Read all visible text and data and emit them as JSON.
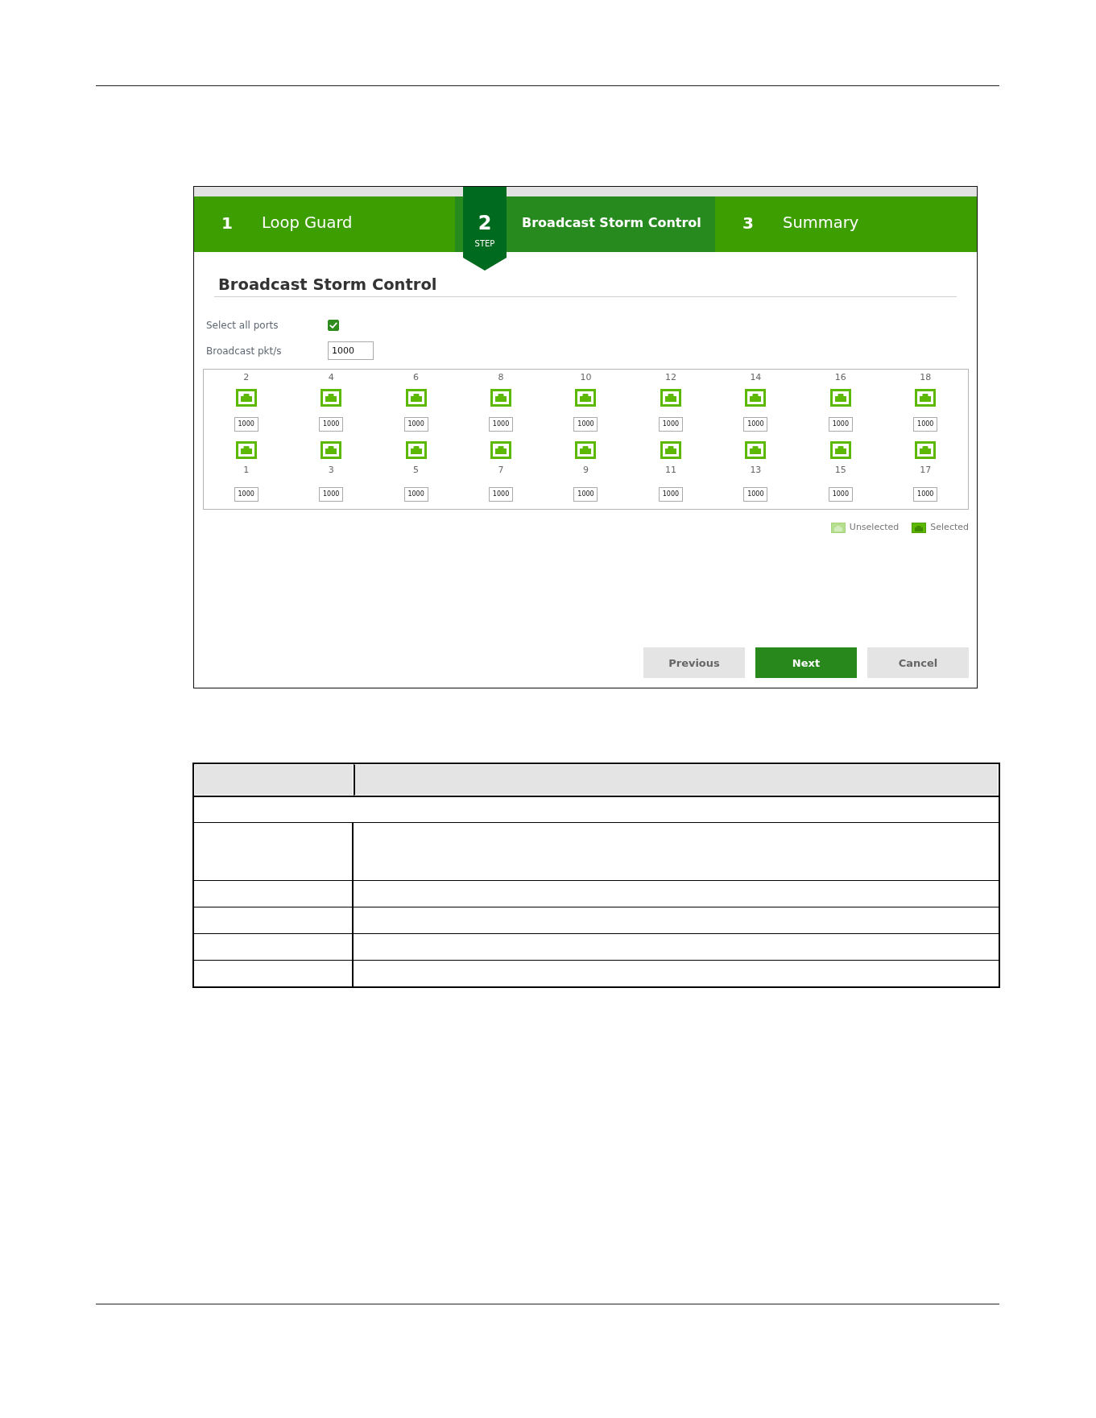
{
  "wizard": {
    "steps": [
      {
        "number": "1",
        "label": "Loop Guard",
        "selected": false
      },
      {
        "number": "2",
        "label": "Broadcast Storm Control",
        "selected": true,
        "badge": "STEP"
      },
      {
        "number": "3",
        "label": "Summary",
        "selected": false
      }
    ]
  },
  "panel": {
    "title": "Broadcast Storm Control",
    "select_all": {
      "label": "Select all ports",
      "checked": true
    },
    "broadcast_rate": {
      "label": "Broadcast pkt/s",
      "value": "1000"
    },
    "port_columns": [
      {
        "top": {
          "label": "2",
          "value": "1000",
          "selected": true
        },
        "bottom": {
          "label": "1",
          "value": "1000",
          "selected": true
        }
      },
      {
        "top": {
          "label": "4",
          "value": "1000",
          "selected": true
        },
        "bottom": {
          "label": "3",
          "value": "1000",
          "selected": true
        }
      },
      {
        "top": {
          "label": "6",
          "value": "1000",
          "selected": true
        },
        "bottom": {
          "label": "5",
          "value": "1000",
          "selected": true
        }
      },
      {
        "top": {
          "label": "8",
          "value": "1000",
          "selected": true
        },
        "bottom": {
          "label": "7",
          "value": "1000",
          "selected": true
        }
      },
      {
        "top": {
          "label": "10",
          "value": "1000",
          "selected": true
        },
        "bottom": {
          "label": "9",
          "value": "1000",
          "selected": true
        }
      },
      {
        "top": {
          "label": "12",
          "value": "1000",
          "selected": true
        },
        "bottom": {
          "label": "11",
          "value": "1000",
          "selected": true
        }
      },
      {
        "top": {
          "label": "14",
          "value": "1000",
          "selected": true
        },
        "bottom": {
          "label": "13",
          "value": "1000",
          "selected": true
        }
      },
      {
        "top": {
          "label": "16",
          "value": "1000",
          "selected": true
        },
        "bottom": {
          "label": "15",
          "value": "1000",
          "selected": true
        }
      },
      {
        "top": {
          "label": "18",
          "value": "1000",
          "selected": true
        },
        "bottom": {
          "label": "17",
          "value": "1000",
          "selected": true
        }
      }
    ],
    "legend": [
      {
        "label": "Unselected",
        "kind": "unselected"
      },
      {
        "label": "Selected",
        "kind": "selected"
      }
    ],
    "buttons": [
      {
        "label": "Previous",
        "kind": "previous"
      },
      {
        "label": "Next",
        "kind": "next"
      },
      {
        "label": "Cancel",
        "kind": "cancel"
      }
    ]
  },
  "table": {
    "rows": [
      {
        "kind": "header"
      },
      {
        "kind": "section"
      },
      {
        "kind": "pair",
        "tall": true
      },
      {
        "kind": "pair",
        "tall": false
      },
      {
        "kind": "pair",
        "tall": false
      },
      {
        "kind": "pair",
        "tall": false
      },
      {
        "kind": "pair",
        "tall": false
      }
    ]
  }
}
